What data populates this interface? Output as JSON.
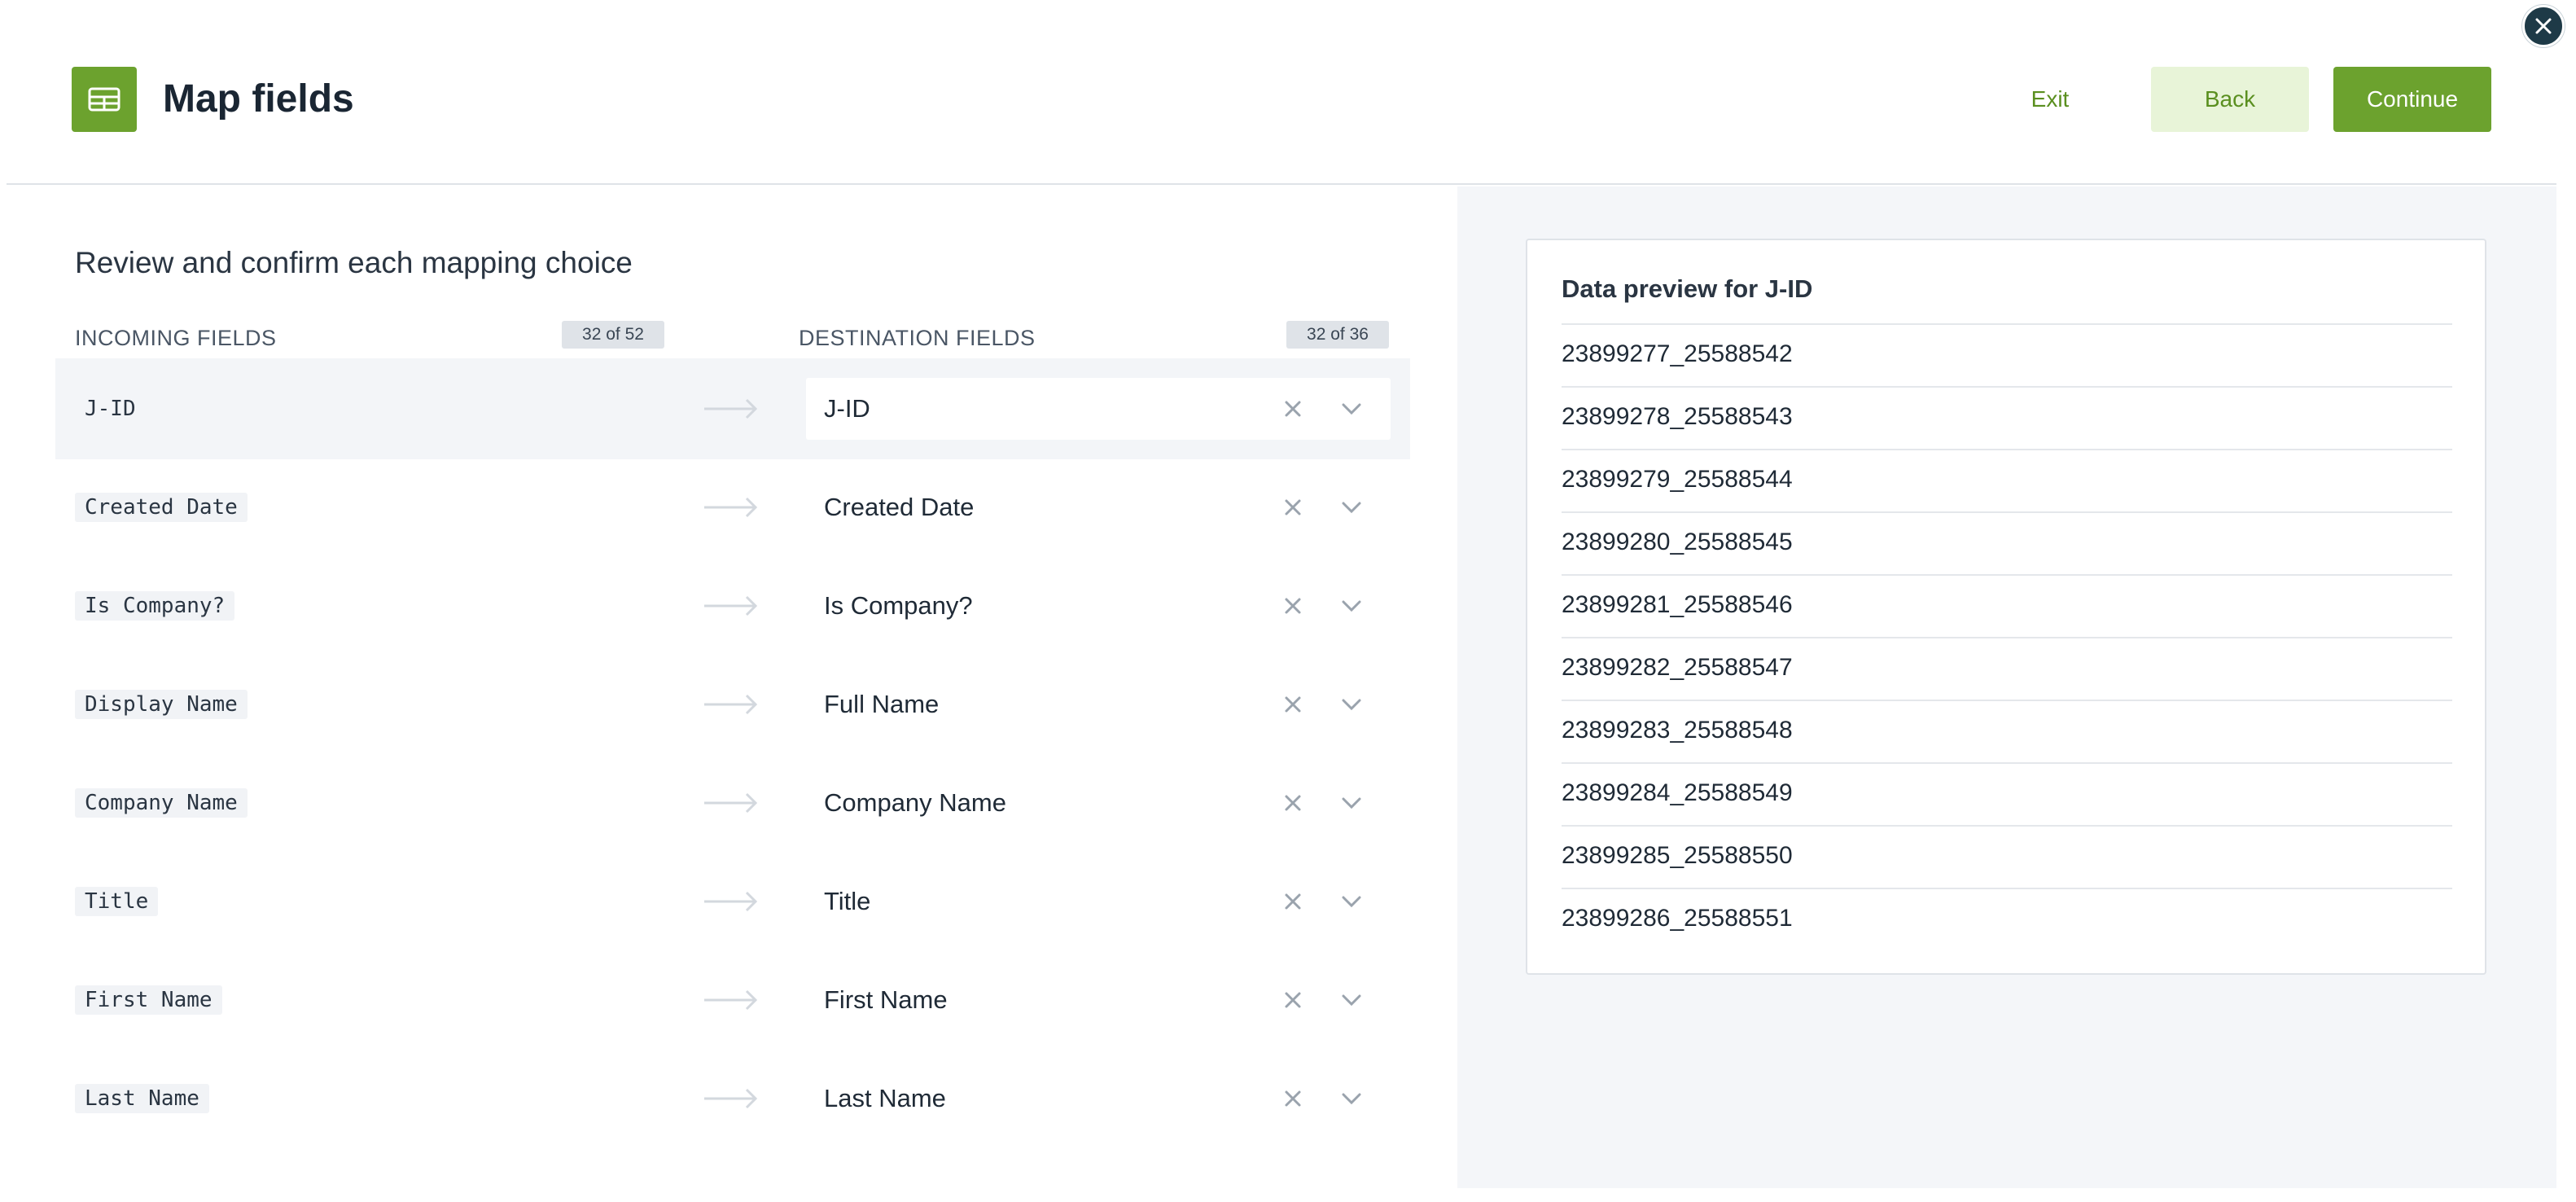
{
  "header": {
    "title": "Map fields",
    "exit_label": "Exit",
    "back_label": "Back",
    "continue_label": "Continue"
  },
  "main": {
    "section_title": "Review and confirm each mapping choice",
    "incoming_header": "INCOMING FIELDS",
    "incoming_count": "32 of 52",
    "destination_header": "DESTINATION FIELDS",
    "destination_count": "32 of 36",
    "rows": [
      {
        "incoming": "J-ID",
        "destination": "J-ID"
      },
      {
        "incoming": "Created Date",
        "destination": "Created Date"
      },
      {
        "incoming": "Is Company?",
        "destination": "Is Company?"
      },
      {
        "incoming": "Display Name",
        "destination": "Full Name"
      },
      {
        "incoming": "Company Name",
        "destination": "Company Name"
      },
      {
        "incoming": "Title",
        "destination": "Title"
      },
      {
        "incoming": "First Name",
        "destination": "First Name"
      },
      {
        "incoming": "Last Name",
        "destination": "Last Name"
      }
    ]
  },
  "preview": {
    "title": "Data preview for J-ID",
    "values": [
      "23899277_25588542",
      "23899278_25588543",
      "23899279_25588544",
      "23899280_25588545",
      "23899281_25588546",
      "23899282_25588547",
      "23899283_25588548",
      "23899284_25588549",
      "23899285_25588550",
      "23899286_25588551"
    ]
  },
  "icons": {
    "header": "table-icon",
    "close": "close-icon",
    "arrow": "arrow-right-icon",
    "clear": "clear-x-icon",
    "dropdown": "chevron-down-icon"
  },
  "colors": {
    "brand_green": "#6ca22e",
    "back_button_bg": "#e8f4d8",
    "close_button_bg": "#1e3a47",
    "right_panel_bg": "#f4f6f9"
  }
}
